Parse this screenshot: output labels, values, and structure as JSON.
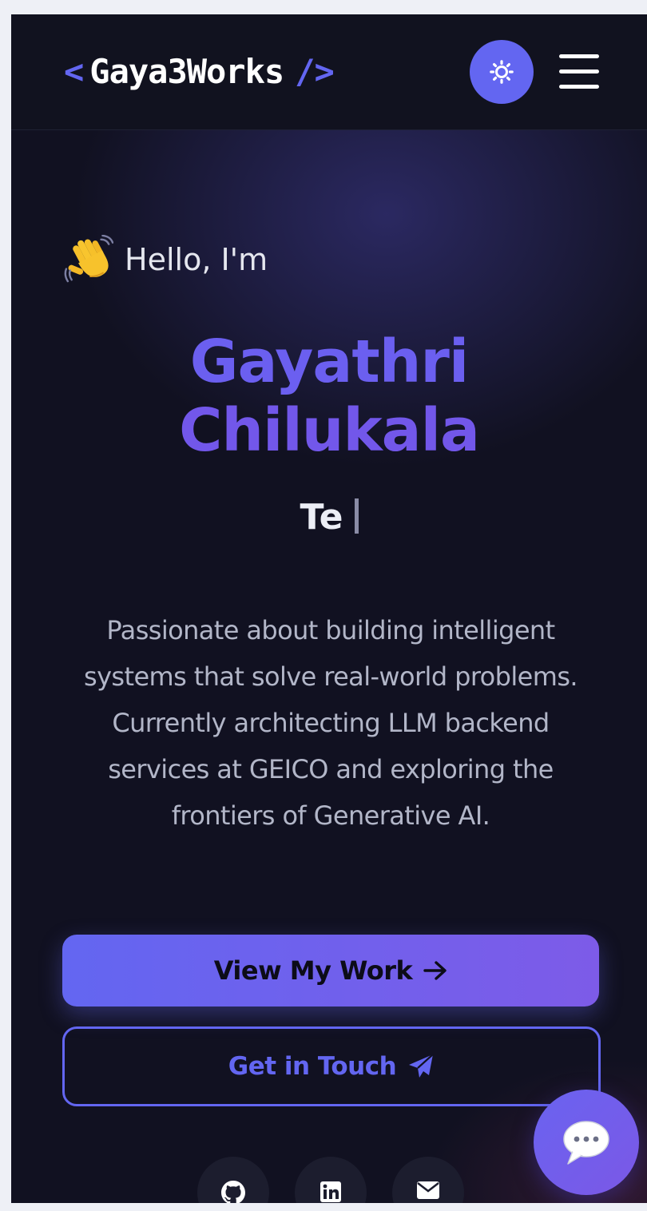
{
  "navbar": {
    "logo_open": "<",
    "logo_name": "Gaya3Works",
    "logo_close": "/>",
    "theme_icon": "sun-icon",
    "menu_icon": "hamburger-menu-icon"
  },
  "hero": {
    "wave_icon": "waving-hand-emoji",
    "greeting": "Hello, I'm",
    "name_line_1": "Gayathri",
    "name_line_2": "Chilukala",
    "typing_text": "Te",
    "description": "Passionate about building intelligent systems that solve real-world problems. Currently architecting LLM backend services at GEICO and exploring the frontiers of Generative AI."
  },
  "buttons": {
    "primary_label": "View My Work",
    "primary_icon": "arrow-right-icon",
    "secondary_label": "Get in Touch",
    "secondary_icon": "paper-plane-icon"
  },
  "social": [
    {
      "icon": "github-icon"
    },
    {
      "icon": "linkedin-icon"
    },
    {
      "icon": "envelope-icon"
    }
  ],
  "chat": {
    "icon": "speech-bubble-icon"
  },
  "colors": {
    "accent": "#6366f1",
    "accent_purple": "#7d5be8",
    "background": "#111121",
    "navbar": "#11121f"
  }
}
